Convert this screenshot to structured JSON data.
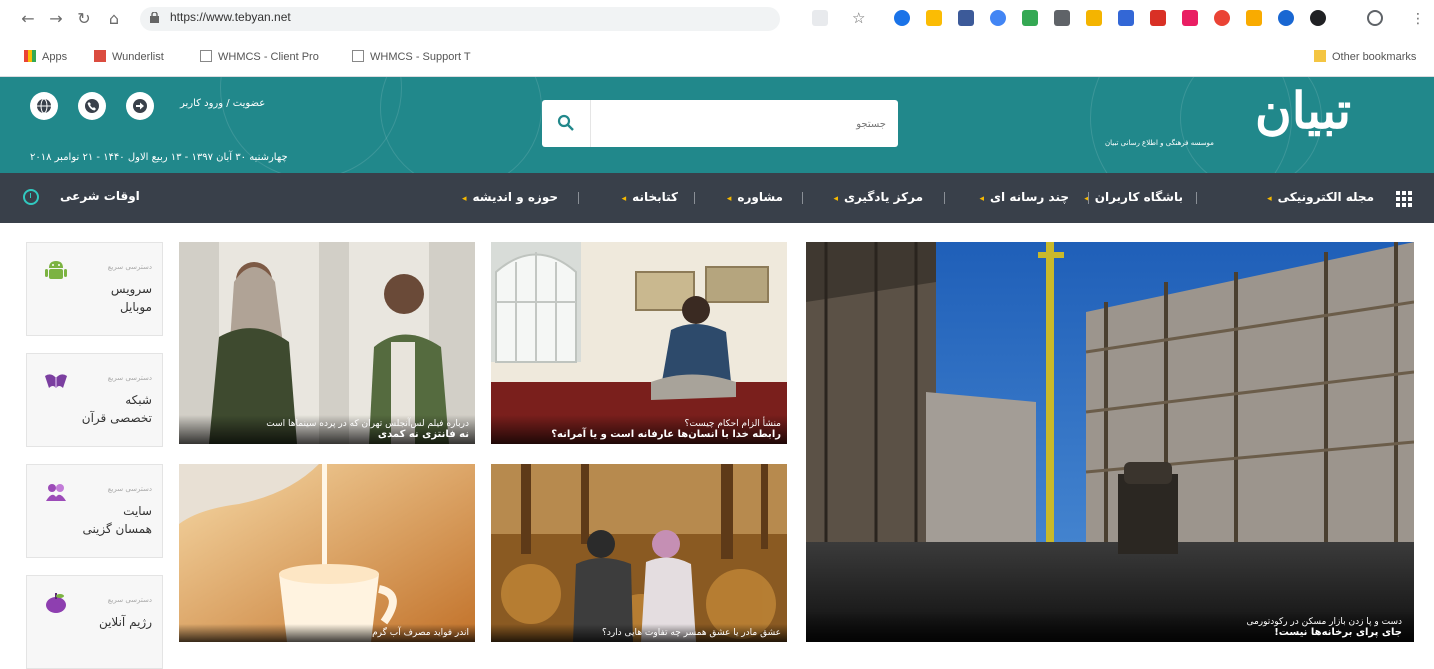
{
  "browser": {
    "url": "https://www.tebyan.net",
    "bookmarks": [
      {
        "label": "Apps"
      },
      {
        "label": "Wunderlist"
      },
      {
        "label": "WHMCS - Client Pro"
      },
      {
        "label": "WHMCS - Support T"
      }
    ],
    "other_bookmarks": "Other bookmarks"
  },
  "header": {
    "login_text": "عضویت / ورود کاربر",
    "date_text": "چهارشنبه ۳۰ آبان ۱۳۹۷ - ۱۳ ربیع الاول ۱۴۴۰ - ۲۱ نوامبر ۲۰۱۸",
    "search_placeholder": "جستجو",
    "logo_text": "تبیان",
    "logo_subtitle": "موسسه فرهنگی و اطلاع رسانی تبیان"
  },
  "nav": {
    "items": [
      "مجله الکترونیکی",
      "باشگاه کاربران",
      "چند رسانه ای",
      "مرکز یادگیری",
      "مشاوره",
      "کتابخانه",
      "حوزه و اندیشه"
    ],
    "owqat": "اوقات شرعی"
  },
  "hero": {
    "subtitle": "دست و پا زدن بازار مسکن در رکودتورمی",
    "title": "جای پرای برخانه‌ها نیست!"
  },
  "cards": [
    {
      "subtitle": "منشأ الزام احکام چیست؟",
      "title": "رابطه خدا با انسان‌ها عارفانه است و یا آمرانه؟"
    },
    {
      "subtitle": "درباره فیلم لس‌آنجلس تهران که در پرده سینماها است",
      "title": "نه فانتزی نه کمدی"
    },
    {
      "subtitle": "عشق مادر یا عشق همسر چه تفاوت هایی دارد؟",
      "title": ""
    },
    {
      "subtitle": "اندر فواید مصرف آب گرم",
      "title": ""
    }
  ],
  "side_services": [
    {
      "tag": "دسترسی سریع",
      "title_line1": "سرویس",
      "title_line2": "موبایل",
      "icon": "android-icon"
    },
    {
      "tag": "دسترسی سریع",
      "title_line1": "شبکه",
      "title_line2": "تخصصی قرآن",
      "icon": "quran-icon"
    },
    {
      "tag": "دسترسی سریع",
      "title_line1": "سایت",
      "title_line2": "همسان گزینی",
      "icon": "matchmaking-icon"
    },
    {
      "tag": "دسترسی سریع",
      "title_line1": "رژیم آنلاین",
      "title_line2": "",
      "icon": "diet-icon"
    }
  ],
  "colors": {
    "header_bg": "#21888b",
    "nav_bg": "#39404a",
    "nav_arrow": "#f6b900",
    "accent": "#31c9c0"
  }
}
